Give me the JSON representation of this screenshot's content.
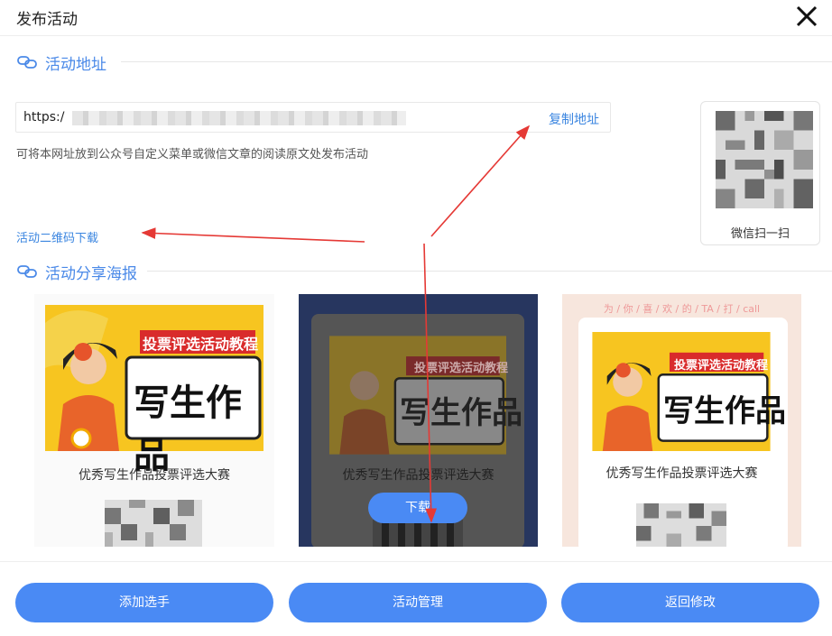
{
  "header": {
    "title": "发布活动",
    "close_icon": "close-icon"
  },
  "address_section": {
    "heading": "活动地址",
    "url_prefix": "https:/",
    "copy_label": "复制地址",
    "hint": "可将本网址放到公众号自定义菜单或微信文章的阅读原文处发布活动",
    "qr_caption": "微信扫一扫",
    "qr_download": "活动二维码下载"
  },
  "poster_section": {
    "heading": "活动分享海报",
    "posters": [
      {
        "banner": "投票评选活动教程",
        "headline": "写生作品",
        "title": "优秀写生作品投票评选大赛"
      },
      {
        "banner": "投票评选活动教程",
        "headline": "写生作品",
        "title": "优秀写生作品投票评选大赛",
        "download_label": "下载"
      },
      {
        "banner": "投票评选活动教程",
        "headline": "写生作品",
        "title": "优秀写生作品投票评选大赛",
        "top_text": "为 / 你 / 喜 / 欢 / 的 / TA / 打 / call"
      }
    ]
  },
  "footer": {
    "add_player": "添加选手",
    "manage": "活动管理",
    "back_edit": "返回修改"
  },
  "colors": {
    "accent": "#4a8af4",
    "link": "#3a85e0",
    "annotation_arrow": "#e53935",
    "poster_yellow": "#f7c520",
    "poster_red": "#d92b2b"
  }
}
